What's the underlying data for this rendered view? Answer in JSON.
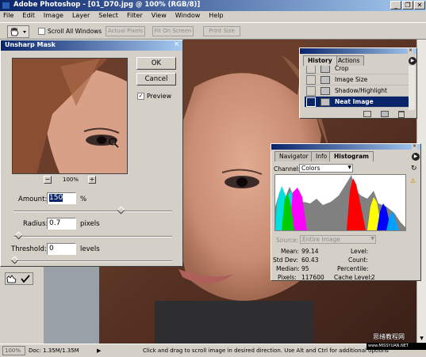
{
  "app": {
    "title": "Adobe Photoshop - [01_D70.jpg @ 100% (RGB/8)]",
    "menus": [
      "File",
      "Edit",
      "Image",
      "Layer",
      "Select",
      "Filter",
      "View",
      "Window",
      "Help"
    ],
    "window_buttons": [
      "_",
      "❐",
      "✕"
    ]
  },
  "options_bar": {
    "scroll_all_windows_label": "Scroll All Windows",
    "scroll_all_windows_checked": false,
    "actual_pixels": "Actual Pixels",
    "fit_on_screen": "Fit On Screen",
    "print_size": "Print Size"
  },
  "unsharp_mask": {
    "title": "Unsharp Mask",
    "close": "×",
    "ok": "OK",
    "cancel": "Cancel",
    "preview_label": "Preview",
    "preview_checked": true,
    "zoom_minus": "−",
    "zoom_level": "100%",
    "zoom_plus": "+",
    "amount_label": "Amount:",
    "amount_value": "150",
    "amount_unit": "%",
    "amount_slider": 0.3,
    "radius_label": "Radius:",
    "radius_value": "0.7",
    "radius_unit": "pixels",
    "radius_slider": 0.002,
    "threshold_label": "Threshold:",
    "threshold_value": "0",
    "threshold_unit": "levels",
    "threshold_slider": 0.0
  },
  "history_panel": {
    "tabs": [
      "History",
      "Actions"
    ],
    "active_tab": "History",
    "items": [
      "Crop",
      "Image Size",
      "Shadow/Highlight",
      "Neat Image"
    ],
    "selected_item": "Neat Image"
  },
  "histogram_panel": {
    "tabs": [
      "Navigator",
      "Info",
      "Histogram"
    ],
    "active_tab": "Histogram",
    "channel_label": "Channel:",
    "channel_value": "Colors",
    "source_label": "Source:",
    "source_value": "Entire Image",
    "stats": {
      "mean_label": "Mean:",
      "mean": "99.14",
      "stddev_label": "Std Dev:",
      "stddev": "60.43",
      "median_label": "Median:",
      "median": "95",
      "pixels_label": "Pixels:",
      "pixels": "117600",
      "level_label": "Level:",
      "level": "",
      "count_label": "Count:",
      "count": "",
      "percentile_label": "Percentile:",
      "percentile": "",
      "cache_label": "Cache Level:",
      "cache": "2"
    }
  },
  "status_bar": {
    "zoom": "100%",
    "doc": "Doc: 1.35M/1.35M",
    "hint": "Click and drag to scroll image in desired direction.  Use Alt and Ctrl for additional options"
  },
  "watermark": {
    "line1": "思绪教程网",
    "line2": "www.MISSYUAN.NET"
  },
  "colors": {
    "title_dark": "#0a246a",
    "title_light": "#a6caf0",
    "chrome": "#d4d0c8"
  }
}
